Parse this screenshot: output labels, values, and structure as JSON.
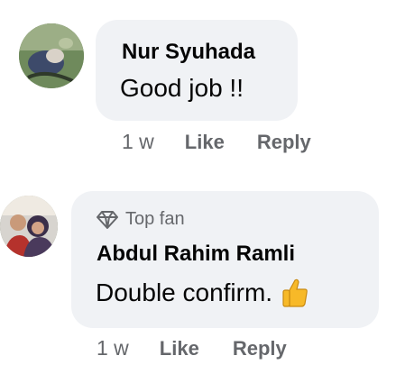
{
  "comments": [
    {
      "author": "Nur Syuhada",
      "text": "Good job !!",
      "time": "1 w",
      "like_label": "Like",
      "reply_label": "Reply"
    },
    {
      "badge": "Top fan",
      "author": "Abdul Rahim Ramli",
      "text": "Double confirm.",
      "emoji_icon": "thumbs-up-icon",
      "time": "1 w",
      "like_label": "Like",
      "reply_label": "Reply"
    }
  ],
  "colors": {
    "bubble": "#f0f2f5",
    "text": "#050505",
    "secondary": "#65676b"
  }
}
